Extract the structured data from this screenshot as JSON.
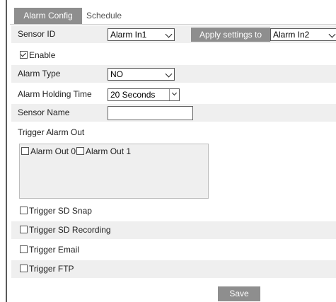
{
  "tabs": {
    "alarm_config": "Alarm Config",
    "schedule": "Schedule"
  },
  "sensor_id": {
    "label": "Sensor ID",
    "value": "Alarm In1"
  },
  "apply_settings": {
    "label": "Apply settings to",
    "value": "Alarm In2"
  },
  "enable": {
    "label": "Enable",
    "checked": true
  },
  "alarm_type": {
    "label": "Alarm Type",
    "value": "NO"
  },
  "holding_time": {
    "label": "Alarm Holding Time",
    "value": "20 Seconds"
  },
  "sensor_name": {
    "label": "Sensor Name",
    "value": ""
  },
  "trigger_alarm_out": {
    "label": "Trigger Alarm Out",
    "items": [
      {
        "label": "Alarm Out 0",
        "checked": false
      },
      {
        "label": "Alarm Out 1",
        "checked": false
      }
    ]
  },
  "triggers": {
    "sd_snap": "Trigger SD Snap",
    "sd_recording": "Trigger SD Recording",
    "email": "Trigger Email",
    "ftp": "Trigger FTP"
  },
  "save_label": "Save",
  "colors": {
    "tab_active": "#8e8e8e",
    "row_shade": "#efefef",
    "button": "#8e8e8e"
  }
}
